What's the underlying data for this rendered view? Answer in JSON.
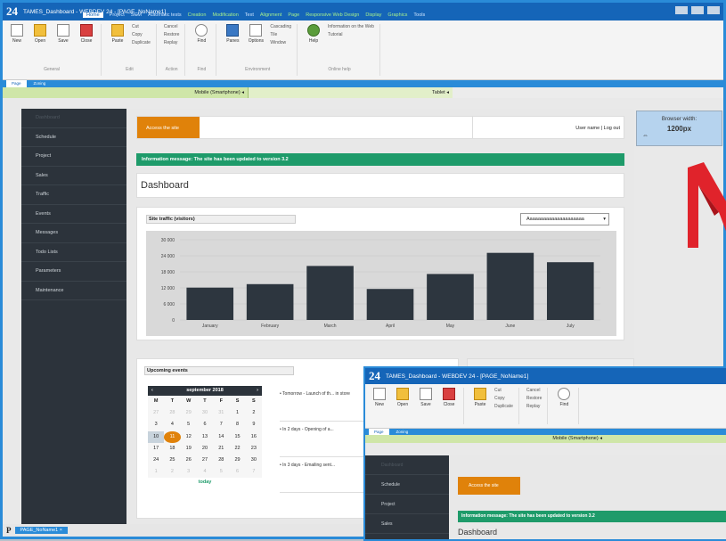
{
  "app": {
    "logo": "24",
    "title": "TAMES_Dashboard - WEBDEV 24 - [PAGE_NoName1]",
    "menu": [
      {
        "label": "Home",
        "active": true
      },
      {
        "label": "Project"
      },
      {
        "label": "SCM"
      },
      {
        "label": "Automatic tests"
      },
      {
        "label": "Creation",
        "green": true
      },
      {
        "label": "Modification",
        "green": true
      },
      {
        "label": "Text"
      },
      {
        "label": "Alignment",
        "green": true
      },
      {
        "label": "Page",
        "green": true
      },
      {
        "label": "Responsive Web Design",
        "green": true
      },
      {
        "label": "Display",
        "green": true
      },
      {
        "label": "Graphics",
        "green": true
      },
      {
        "label": "Tools"
      }
    ]
  },
  "ribbon": {
    "general": {
      "items": [
        "New",
        "Open",
        "Save",
        "Close"
      ],
      "label": "General"
    },
    "edit": {
      "paste": "Paste",
      "cut": "Cut",
      "copy": "Copy",
      "duplicate": "Duplicate",
      "label": "Edit"
    },
    "action": {
      "cancel": "Cancel",
      "restore": "Restore",
      "replay": "Replay",
      "label": "Action"
    },
    "find": {
      "find": "Find",
      "label": "Find"
    },
    "env": {
      "panes": "Panes",
      "options": "Options",
      "cascading": "Cascading",
      "tile": "Tile",
      "window": "Window",
      "label": "Environment"
    },
    "help": {
      "help": "Help",
      "web": "Information on the Web",
      "tutorial": "Tutorial",
      "label": "Online help"
    }
  },
  "subtabs": [
    "Page",
    "Zoning"
  ],
  "breakpoints": {
    "mobile": "Mobile (Smartphone) ◂",
    "tablet": "Tablet ◂"
  },
  "sidebar": {
    "items": [
      "Dashboard",
      "Schedule",
      "Project",
      "Sales",
      "Traffic",
      "Events",
      "Messages",
      "Todo Lists",
      "Parameters",
      "Maintenance"
    ],
    "active_index": 0
  },
  "header": {
    "access_button": "Access the site",
    "user_links": "User name | Log out"
  },
  "info_message": "Information message: The site has been updated to version 3.2",
  "dashboard_title": "Dashboard",
  "traffic": {
    "panel_title": "Site traffic (visitors)",
    "select_value": "Aaaaaaaaaaaaaaaaaaaaa"
  },
  "chart_data": {
    "type": "bar",
    "title": "Site traffic (visitors)",
    "categories": [
      "January",
      "February",
      "March",
      "April",
      "May",
      "June",
      "July"
    ],
    "values": [
      12100,
      13400,
      20200,
      11600,
      17200,
      25100,
      21600
    ],
    "ylim": [
      0,
      30000
    ],
    "yticks": [
      "0",
      "6 000",
      "12 000",
      "18 000",
      "24 000",
      "30 000"
    ],
    "grid": true,
    "bar_color": "#2d363f"
  },
  "events": {
    "panel_title": "Upcoming events",
    "calendar": {
      "month": "september 2018",
      "prev": "‹",
      "next": "›",
      "weekdays": [
        "M",
        "T",
        "W",
        "T",
        "F",
        "S",
        "S"
      ],
      "days": [
        "27",
        "28",
        "29",
        "30",
        "31",
        "1",
        "2",
        "3",
        "4",
        "5",
        "6",
        "7",
        "8",
        "9",
        "10",
        "11",
        "12",
        "13",
        "14",
        "15",
        "16",
        "17",
        "18",
        "19",
        "20",
        "21",
        "22",
        "23",
        "24",
        "25",
        "26",
        "27",
        "28",
        "29",
        "30",
        "1",
        "2",
        "3",
        "4",
        "5",
        "6",
        "7"
      ],
      "today_button": "today"
    },
    "list": [
      "• Tomorrow - Launch of th... in store",
      "• In 2 days - Opening of a...",
      "• In 3 days - Emailing sent..."
    ]
  },
  "browser_width": {
    "label": "Browser width:",
    "value": "1200px"
  },
  "status": {
    "page_tab": "PAGE_NoName1 ×"
  },
  "colors": {
    "accent": "#2a8bd8",
    "orange": "#e0820a",
    "green": "#1e9b6a",
    "sidebar": "#2c333b"
  }
}
